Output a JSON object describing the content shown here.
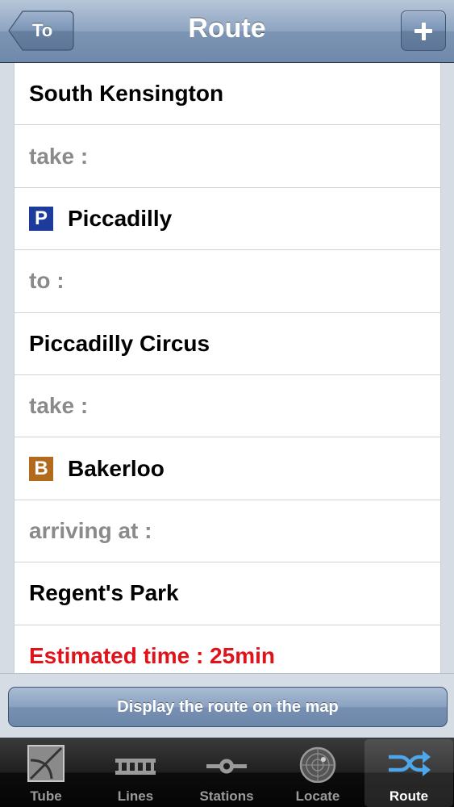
{
  "navbar": {
    "title": "Route",
    "back_label": "To",
    "add_icon": "plus-icon"
  },
  "route": {
    "origin": "South Kensington",
    "take_label_1": "take :",
    "line_1": {
      "badge": "P",
      "name": "Piccadilly",
      "color": "#1d3b9a"
    },
    "to_label": "to :",
    "change_station": "Piccadilly Circus",
    "take_label_2": "take :",
    "line_2": {
      "badge": "B",
      "name": "Bakerloo",
      "color": "#b26a1c"
    },
    "arriving_label": "arriving at :",
    "destination": "Regent's Park",
    "estimate": "Estimated time : 25min",
    "estimate_color": "#e0131b"
  },
  "action": {
    "display_route_label": "Display the route on the map"
  },
  "tabbar": {
    "tabs": [
      {
        "label": "Tube",
        "icon": "tube-map-icon"
      },
      {
        "label": "Lines",
        "icon": "lines-icon"
      },
      {
        "label": "Stations",
        "icon": "station-icon"
      },
      {
        "label": "Locate",
        "icon": "radar-icon"
      },
      {
        "label": "Route",
        "icon": "shuffle-route-icon"
      }
    ],
    "active": "Route"
  }
}
